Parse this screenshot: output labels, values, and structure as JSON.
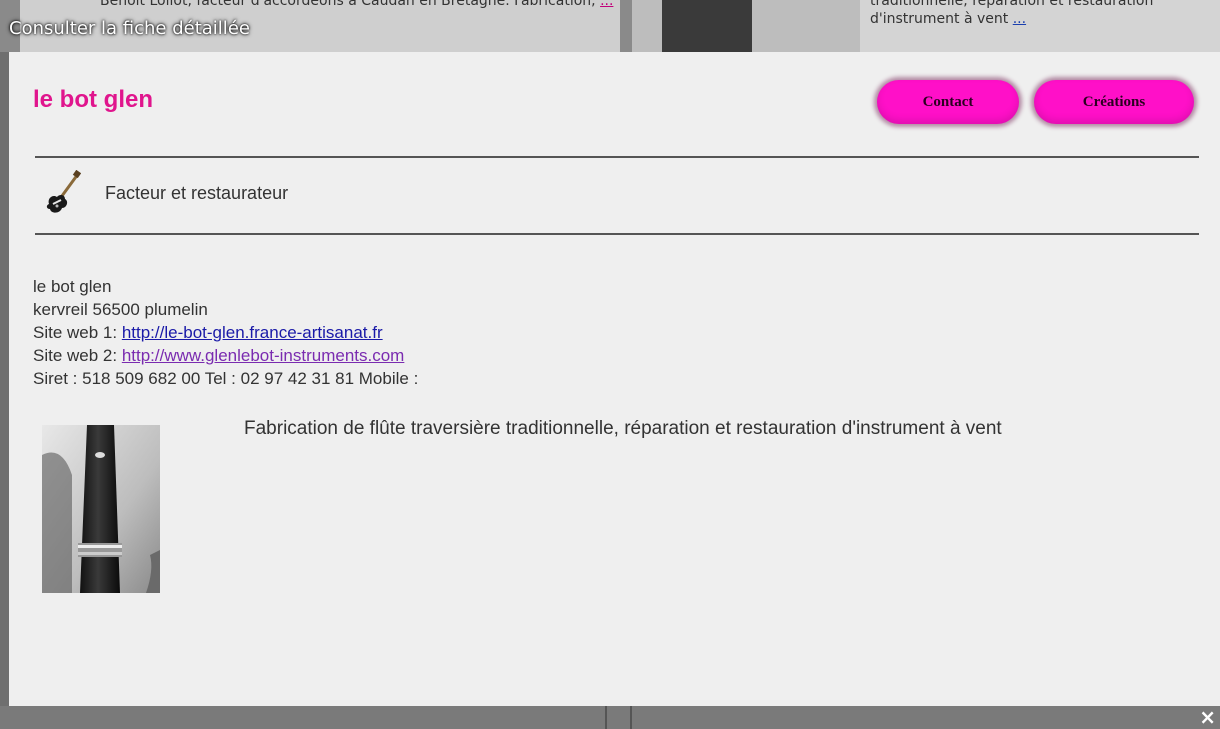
{
  "background": {
    "left_snippet": "Benoit Loliot, facteur d'accordéons à Caudan en Bretagne. Fabrication,",
    "left_more": "...",
    "right_snippet": "traditionnelle, réparation et restauration d'instrument à vent",
    "right_more": "...",
    "overlay_title": "Consulter la fiche détaillée",
    "close_label": "×"
  },
  "header": {
    "name": "le bot glen",
    "buttons": {
      "contact": "Contact",
      "creations": "Créations"
    }
  },
  "category": {
    "icon": "guitar-icon",
    "label": "Facteur et restaurateur"
  },
  "info": {
    "line_name": "le bot glen",
    "line_address": "kervreil 56500 plumelin",
    "site1_label": "Site web 1: ",
    "site1_url": "http://le-bot-glen.france-artisanat.fr",
    "site2_label": "Site web 2: ",
    "site2_url": "http://www.glenlebot-instruments.com",
    "siret_line": "Siret : 518 509 682 00 Tel : 02 97 42 31 81   Mobile :"
  },
  "description": "Fabrication de flûte traversière traditionnelle, réparation et restauration d'instrument à vent",
  "colors": {
    "accent_pink": "#e0158d",
    "button_pink": "#ff10c8"
  }
}
